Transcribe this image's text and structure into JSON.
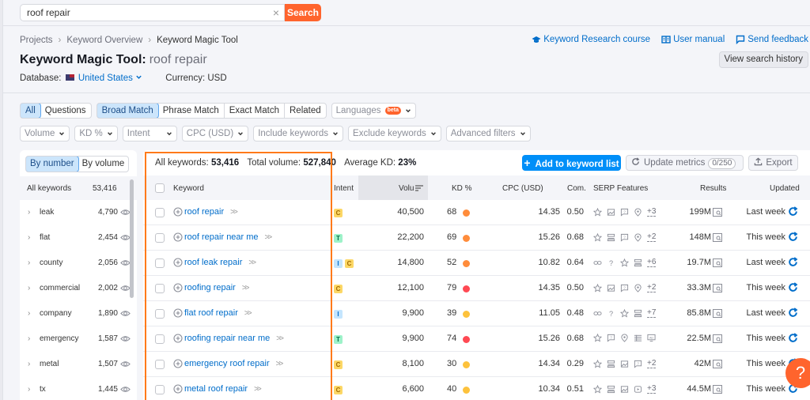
{
  "search": {
    "value": "roof repair",
    "button_label": "Search"
  },
  "breadcrumb": [
    "Projects",
    "Keyword Overview",
    "Keyword Magic Tool"
  ],
  "title": {
    "tool": "Keyword Magic Tool:",
    "query": "roof repair"
  },
  "database": {
    "label": "Database:",
    "country": "United States",
    "currency": "Currency: USD"
  },
  "top_links": {
    "course": "Keyword Research course",
    "manual": "User manual",
    "feedback": "Send feedback",
    "history": "View search history"
  },
  "filters": {
    "type_tabs": [
      {
        "label": "All",
        "active": true
      },
      {
        "label": "Questions",
        "active": false
      }
    ],
    "match_tabs": [
      {
        "label": "Broad Match",
        "active": true
      },
      {
        "label": "Phrase Match",
        "active": false
      },
      {
        "label": "Exact Match",
        "active": false
      },
      {
        "label": "Related",
        "active": false
      }
    ],
    "languages": {
      "label": "Languages",
      "badge": "beta"
    },
    "dropdowns": [
      "Volume",
      "KD %",
      "Intent",
      "CPC (USD)",
      "Include keywords",
      "Exclude keywords",
      "Advanced filters"
    ]
  },
  "sidebar": {
    "toggle": [
      {
        "label": "By number",
        "active": true
      },
      {
        "label": "By volume",
        "active": false
      }
    ],
    "all": {
      "label": "All keywords",
      "count": "53,416"
    },
    "groups": [
      {
        "label": "leak",
        "count": "4,790"
      },
      {
        "label": "flat",
        "count": "2,454"
      },
      {
        "label": "county",
        "count": "2,056"
      },
      {
        "label": "commercial",
        "count": "2,002"
      },
      {
        "label": "company",
        "count": "1,890"
      },
      {
        "label": "emergency",
        "count": "1,587"
      },
      {
        "label": "metal",
        "count": "1,507"
      },
      {
        "label": "tx",
        "count": "1,445"
      }
    ]
  },
  "summary": {
    "all_label": "All keywords:",
    "all_value": "53,416",
    "vol_label": "Total volume:",
    "vol_value": "527,840",
    "kd_label": "Average KD:",
    "kd_value": "23%"
  },
  "actions": {
    "add": "Add to keyword list",
    "update": "Update metrics",
    "update_count": "0/250",
    "export": "Export"
  },
  "columns": {
    "keyword": "Keyword",
    "intent": "Intent",
    "volume": "Volu",
    "kd": "KD %",
    "cpc": "CPC (USD)",
    "com": "Com.",
    "serp": "SERP Features",
    "results": "Results",
    "updated": "Updated"
  },
  "colors": {
    "kd_orange": "#ff8c3b",
    "kd_red": "#ff4953",
    "kd_yellow": "#fdc23c",
    "accent": "#ff642d",
    "link": "#006dca"
  },
  "rows": [
    {
      "keyword": "roof repair",
      "intents": [
        "C"
      ],
      "volume": "40,500",
      "kd": "68",
      "kd_level": "orange",
      "cpc": "14.35",
      "com": "0.50",
      "serp": [
        "star",
        "image",
        "faq",
        "local"
      ],
      "serp_more": "+3",
      "results": "199M",
      "updated": "Last week"
    },
    {
      "keyword": "roof repair near me",
      "intents": [
        "T"
      ],
      "volume": "22,200",
      "kd": "69",
      "kd_level": "orange",
      "cpc": "15.26",
      "com": "0.68",
      "serp": [
        "star",
        "sitelinks",
        "faq",
        "local"
      ],
      "serp_more": "+2",
      "results": "148M",
      "updated": "This week"
    },
    {
      "keyword": "roof leak repair",
      "intents": [
        "I",
        "C"
      ],
      "volume": "14,800",
      "kd": "52",
      "kd_level": "orange",
      "cpc": "10.82",
      "com": "0.64",
      "serp": [
        "link",
        "question",
        "star",
        "sitelinks"
      ],
      "serp_more": "+6",
      "results": "19.7M",
      "updated": "Last week"
    },
    {
      "keyword": "roofing repair",
      "intents": [
        "C"
      ],
      "volume": "12,100",
      "kd": "79",
      "kd_level": "red",
      "cpc": "14.35",
      "com": "0.50",
      "serp": [
        "star",
        "image",
        "faq",
        "local"
      ],
      "serp_more": "+2",
      "results": "33.3M",
      "updated": "This week"
    },
    {
      "keyword": "flat roof repair",
      "intents": [
        "I"
      ],
      "volume": "9,900",
      "kd": "39",
      "kd_level": "yellow",
      "cpc": "11.05",
      "com": "0.48",
      "serp": [
        "link",
        "question",
        "star",
        "sitelinks"
      ],
      "serp_more": "+7",
      "results": "85.8M",
      "updated": "Last week"
    },
    {
      "keyword": "roofing repair near me",
      "intents": [
        "T"
      ],
      "volume": "9,900",
      "kd": "74",
      "kd_level": "red",
      "cpc": "15.26",
      "com": "0.68",
      "serp": [
        "star",
        "faq",
        "local",
        "list",
        "ads"
      ],
      "serp_more": "",
      "results": "22.5M",
      "updated": "This week"
    },
    {
      "keyword": "emergency roof repair",
      "intents": [
        "C"
      ],
      "volume": "8,100",
      "kd": "30",
      "kd_level": "yellow",
      "cpc": "14.34",
      "com": "0.29",
      "serp": [
        "star",
        "sitelinks",
        "image",
        "faq"
      ],
      "serp_more": "+2",
      "results": "42M",
      "updated": "This week"
    },
    {
      "keyword": "metal roof repair",
      "intents": [
        "C"
      ],
      "volume": "6,600",
      "kd": "40",
      "kd_level": "yellow",
      "cpc": "10.34",
      "com": "0.51",
      "serp": [
        "star",
        "sitelinks",
        "image",
        "video"
      ],
      "serp_more": "+3",
      "results": "44.5M",
      "updated": "This week"
    }
  ],
  "help": "?"
}
